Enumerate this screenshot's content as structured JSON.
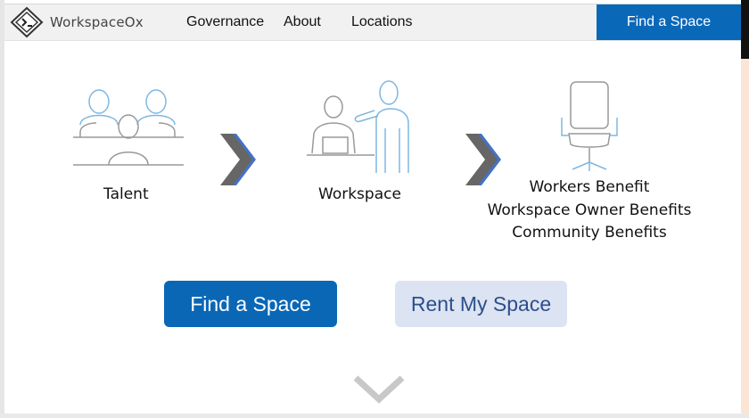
{
  "brand": {
    "name": "WorkspaceOx",
    "logo_icon": "terminal-diamond-icon"
  },
  "nav": {
    "links": [
      "Governance",
      "About",
      "Locations"
    ],
    "cta": "Find a Space"
  },
  "colors": {
    "primary": "#0a68b8",
    "secondary_bg": "#dce3f2",
    "secondary_text": "#2c4f8c",
    "illustration_stroke": "#7fb7e2",
    "chevron": "#666666"
  },
  "steps": [
    {
      "label": "Talent",
      "icon": "team-meeting-icon"
    },
    {
      "label": "Workspace",
      "icon": "presenter-desk-icon"
    },
    {
      "label_lines": [
        "Workers Benefit",
        "Workspace Owner Benefits",
        "Community Benefits"
      ],
      "icon": "office-chair-icon"
    }
  ],
  "actions": {
    "primary": "Find a Space",
    "secondary": "Rent My Space"
  },
  "scroll_icon": "chevron-down-icon"
}
